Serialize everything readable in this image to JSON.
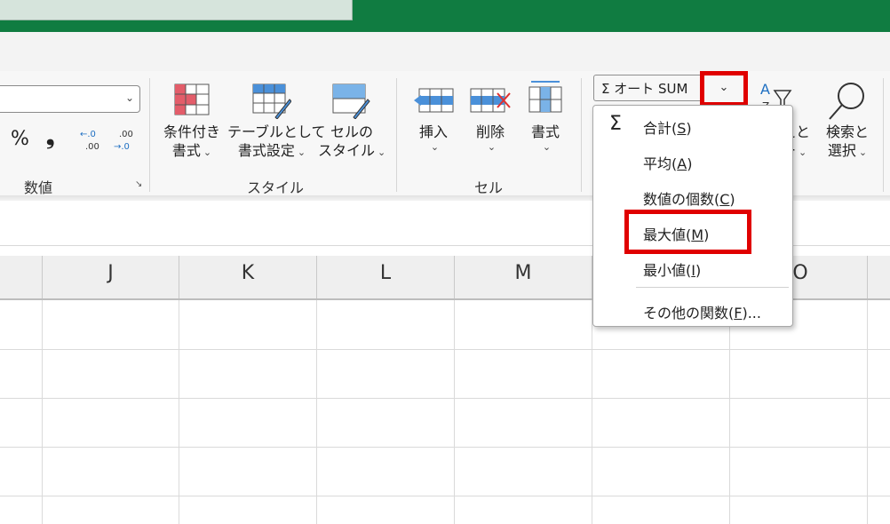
{
  "ribbon": {
    "number_group": {
      "label": "数値",
      "percent": "%",
      "comma": "❟",
      "dec_increase": ".0→.00",
      "dec_decrease": ".00→.0"
    },
    "styles_group": {
      "label": "スタイル",
      "conditional_format_l1": "条件付き",
      "conditional_format_l2": "書式",
      "table_format_l1": "テーブルとして",
      "table_format_l2": "書式設定",
      "cell_styles_l1": "セルの",
      "cell_styles_l2": "スタイル"
    },
    "cells_group": {
      "label": "セル",
      "insert": "挿入",
      "delete": "削除",
      "format": "書式"
    },
    "editing_group": {
      "autosum_label": "Σ オート SUM",
      "sort_filter_l1": "えと",
      "sort_filter_l2": "ー",
      "find_select_l1": "検索と",
      "find_select_l2": "選択"
    }
  },
  "menu": {
    "items": [
      {
        "icon": "Σ",
        "text": "合計(",
        "key": "S",
        "end": ")"
      },
      {
        "text": "平均(",
        "key": "A",
        "end": ")"
      },
      {
        "text": "数値の個数(",
        "key": "C",
        "end": ")"
      },
      {
        "text": "最大値(",
        "key": "M",
        "end": ")"
      },
      {
        "text": "最小値(",
        "key": "I",
        "end": ")"
      },
      {
        "text": "その他の関数(",
        "key": "F",
        "end": ")..."
      }
    ]
  },
  "grid": {
    "columns": [
      "J",
      "K",
      "L",
      "M",
      "O"
    ]
  },
  "colors": {
    "accent": "#107c41",
    "highlight": "#e00000"
  }
}
